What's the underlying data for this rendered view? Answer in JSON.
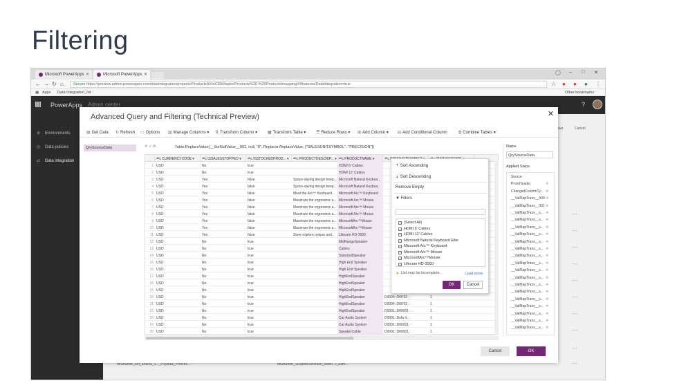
{
  "slide": {
    "title": "Filtering"
  },
  "browser": {
    "tabs": [
      {
        "label": "Microsoft PowerApps"
      },
      {
        "label": "Microsoft PowerApps"
      }
    ],
    "url_secure": "Secure",
    "url": "https://preview.admin.powerapps.com/dataintegration/projects/ProductsAXtoCRM/tasks/Products%20-%20Products/mapping/#/features/DataIntegration=true",
    "bookmarks_apps": "Apps",
    "bookmarks_item": "Data Integration_Int",
    "other_bookmarks": "Other bookmarks"
  },
  "app": {
    "title": "PowerApps",
    "breadcrumb": "Admin center",
    "help": "?",
    "nav": [
      {
        "label": "Environments",
        "icon": "globe-icon"
      },
      {
        "label": "Data policies",
        "icon": "shield-icon"
      },
      {
        "label": "Data integration",
        "icon": "integration-icon"
      }
    ],
    "bg_actions": [
      "Save",
      "Cancel"
    ]
  },
  "modal": {
    "title": "Advanced Query and Filtering (Technical Preview)",
    "toolbar": [
      "Get Data",
      "Refresh",
      "Options",
      "Manage Columns",
      "Transform Column",
      "Transform Table",
      "Reduce Rows",
      "Add Column",
      "Add Conditional Column",
      "Combine Tables"
    ],
    "query_item": "QrySourceData",
    "formula": "Table.ReplaceValue(__ScrNullValue__001, null, \"0\", Replacer.ReplaceValue, {\"SALESUNITSYMBOL\", \"PRECISION\"})",
    "columns": [
      "CURRENCYCODE",
      "ISSALESSTOPPED",
      "ISSTOCKEDPROD...",
      "PRODUCTDESCRIP...",
      "PRODUCTNAME",
      "PRODUCTNUMBER",
      "PRODUCTTYPE"
    ],
    "rows": [
      [
        "1",
        "USD",
        "No",
        "true",
        "",
        "HDMI 6' Cables",
        "",
        ""
      ],
      [
        "2",
        "USD",
        "No",
        "true",
        "",
        "HDMI 12' Cables",
        "",
        ""
      ],
      [
        "3",
        "USD",
        "Yes",
        "false",
        "Space-saving design keep...",
        "Microsoft Natural Keyboa...",
        "",
        ""
      ],
      [
        "4",
        "USD",
        "Yes",
        "false",
        "Space-saving design keep...",
        "Microsoft Natural Keyboa...",
        "",
        ""
      ],
      [
        "5",
        "USD",
        "Yes",
        "false",
        "Meet the Arc™ Keyboard...",
        "Microsoft Arc™ Keyboard",
        "",
        ""
      ],
      [
        "6",
        "USD",
        "Yes",
        "false",
        "Maximize the ergonomic a...",
        "Microsoft Arc™ Mouse",
        "",
        ""
      ],
      [
        "7",
        "USD",
        "Yes",
        "false",
        "Maximize the ergonomic a...",
        "Microsoft Arc™ Mouse",
        "",
        ""
      ],
      [
        "8",
        "USD",
        "Yes",
        "false",
        "Maximize the ergonomic a...",
        "Microsoft Arc™ Mouse",
        "",
        ""
      ],
      [
        "9",
        "USD",
        "Yes",
        "false",
        "Maximize the ergonomic a...",
        "MicrosoftArc™Mouse",
        "",
        ""
      ],
      [
        "10",
        "USD",
        "Yes",
        "false",
        "Maximize the ergonomic a...",
        "MicrosoftArc™Mouse",
        "",
        ""
      ],
      [
        "11",
        "USD",
        "Yes",
        "false",
        "Store explore unique and...",
        "Lifecam HD-3000",
        "",
        ""
      ],
      [
        "12",
        "USD",
        "No",
        "true",
        "",
        "MidRangeSpeaker",
        "",
        ""
      ],
      [
        "13",
        "USD",
        "No",
        "true",
        "",
        "Cables",
        "",
        ""
      ],
      [
        "14",
        "USD",
        "No",
        "true",
        "",
        "StandardSpeaker",
        "",
        ""
      ],
      [
        "15",
        "USD",
        "No",
        "true",
        "",
        "High End Speaker",
        "",
        ""
      ],
      [
        "16",
        "USD",
        "No",
        "true",
        "",
        "High End Speaker",
        "",
        ""
      ],
      [
        "17",
        "USD",
        "No",
        "true",
        "",
        "HighEndSpeaker",
        "",
        ""
      ],
      [
        "18",
        "USD",
        "No",
        "true",
        "",
        "HighEndSpeaker",
        "",
        ""
      ],
      [
        "19",
        "USD",
        "No",
        "true",
        "",
        "HighEndSpeaker",
        "",
        ""
      ],
      [
        "20",
        "USD",
        "No",
        "true",
        "",
        "HighEndSpeaker",
        "D0004::D00'02 : :",
        "1"
      ],
      [
        "21",
        "USD",
        "No",
        "true",
        "",
        "HighEndSpeaker",
        "D0004::D00'02 : :",
        "1"
      ],
      [
        "22",
        "USD",
        "No",
        "true",
        "",
        "HighEndSpeaker",
        "D0001::D00001 : :",
        "1"
      ],
      [
        "23",
        "USD",
        "No",
        "true",
        "",
        "Car Audio System",
        "D0001::Defa lt : :",
        "1"
      ],
      [
        "24",
        "USD",
        "No",
        "true",
        "",
        "Car Audio System",
        "D0001::D00001 : :",
        "1"
      ],
      [
        "25",
        "USD",
        "No",
        "true",
        "",
        "SpeakerCable",
        "D0001::D00001 : :",
        "1"
      ]
    ],
    "filter_menu": {
      "sort_asc": "Sort Ascending",
      "sort_desc": "Sort Descending",
      "remove_empty": "Remove Empty",
      "filters": "Filters",
      "search_placeholder": "",
      "options": [
        {
          "label": "(Select All)",
          "checked": true
        },
        {
          "label": "HDMI 6' Cables",
          "checked": true
        },
        {
          "label": "HDMI 12' Cables",
          "checked": true
        },
        {
          "label": "Microsoft Natural Keyboard Elite",
          "checked": true
        },
        {
          "label": "Microsoft Arc™ Keyboard",
          "checked": true
        },
        {
          "label": "Microsoft Arc™ Mouse",
          "checked": true
        },
        {
          "label": "MicrosoftArc™Mouse",
          "checked": true
        },
        {
          "label": "Lifecam HD-3000",
          "checked": true
        }
      ],
      "warning": "List may be incomplete.",
      "load_more": "Load more",
      "ok": "OK",
      "cancel": "Cancel"
    },
    "settings": {
      "name_label": "Name",
      "name_value": "QrySourceData",
      "steps_label": "Applied Steps",
      "steps": [
        "Source",
        "PromHeader",
        "ChangedColumnTy...",
        "__ValMapTrans__000",
        "__ValMapTrans__001",
        "__ValMapTrans__s...",
        "__ValMapTrans__s...",
        "__ValMapTrans__s...",
        "__ValMapTrans__s...",
        "__ValMapTrans__s...",
        "__ValMapTrans__s...",
        "__ValMapTrans__s...",
        "__ValMapTrans__s...",
        "__ValMapTrans__s...",
        "__ValMapTrans__s...",
        "__ValMapTrans__s...",
        "__ValMapTrans__s...",
        "__ValMapTrans__s...",
        "__ValMapTrans__s...",
        "__ValMapTrans__s...",
        "__ValMapTrans__s...",
        "__ValMapTrans__s..."
      ]
    },
    "cancel": "Cancel",
    "ok": "OK"
  },
  "background_rows": [
    "mrsAuthor_Ion_Enlucu_1..._PSyntax_Procrec...",
    "mrsAuthor_ScriptionScfsnum_Ionen...t_Elim..."
  ],
  "colors": {
    "accent": "#742774",
    "appbar": "#2b2b2b",
    "highlight": "#f1e6f3"
  }
}
